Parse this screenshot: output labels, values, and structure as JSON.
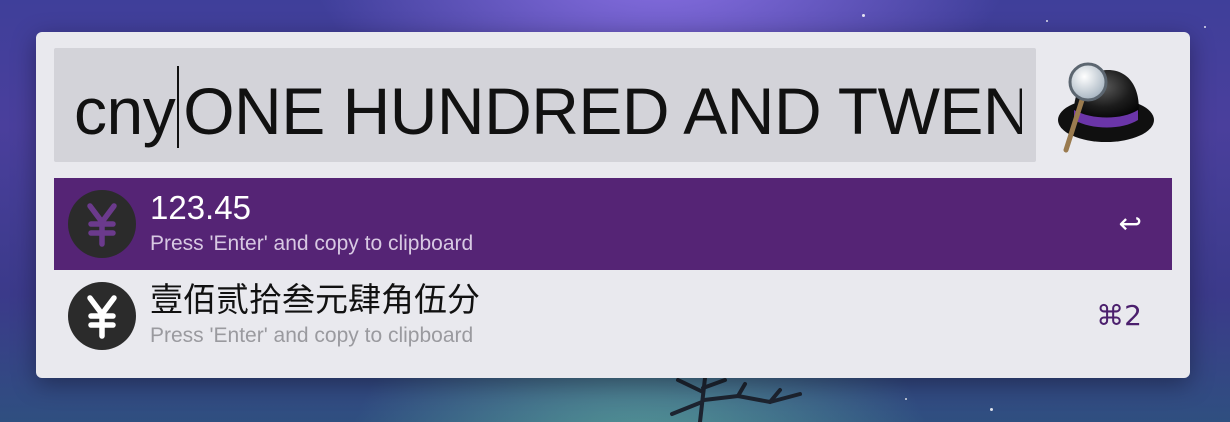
{
  "search": {
    "keyword": "cny",
    "query": "ONE HUNDRED AND TWENTY THREE POINT FOUR FIVE"
  },
  "app": {
    "icon": "alfred-hat-icon"
  },
  "results": [
    {
      "title": "123.45",
      "subtitle": "Press 'Enter' and copy to clipboard",
      "shortcut": "↩",
      "icon": "yuan-icon",
      "selected": true
    },
    {
      "title": "壹佰贰拾叁元肆角伍分",
      "subtitle": "Press 'Enter' and copy to clipboard",
      "shortcut": "⌘2",
      "icon": "yuan-icon",
      "selected": false
    }
  ],
  "colors": {
    "selection": "#552475",
    "shortcut_accent": "#4b1f6d",
    "window": "#e9e9ee",
    "search_field": "#d3d3d9"
  }
}
